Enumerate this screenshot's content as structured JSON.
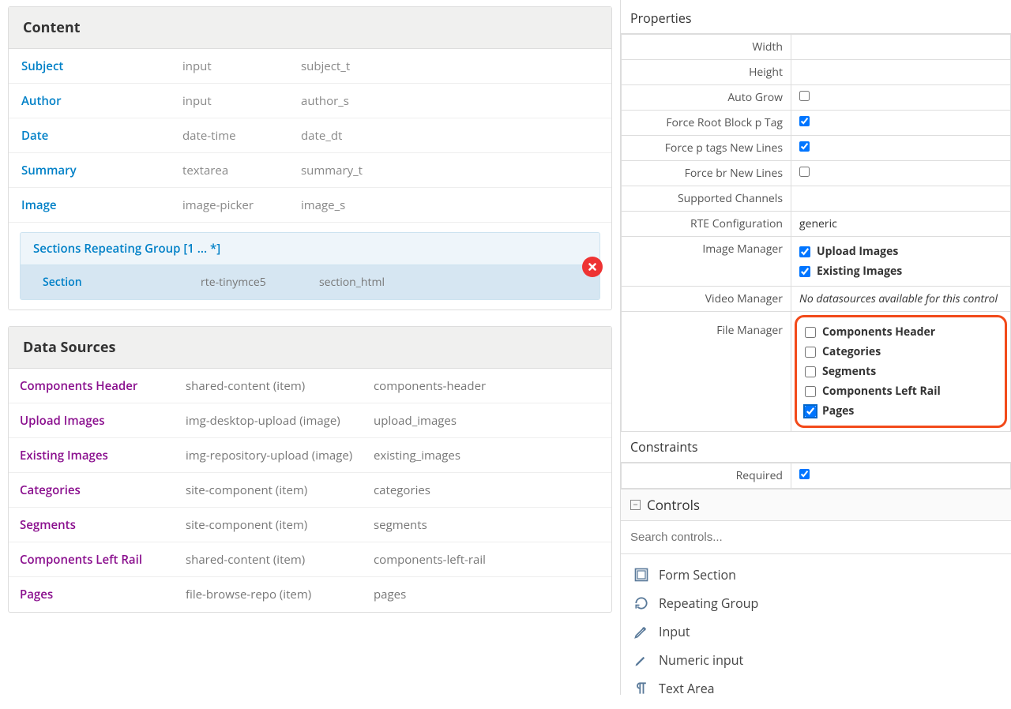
{
  "content": {
    "title": "Content",
    "fields": [
      {
        "label": "Subject",
        "type": "input",
        "var": "subject_t"
      },
      {
        "label": "Author",
        "type": "input",
        "var": "author_s"
      },
      {
        "label": "Date",
        "type": "date-time",
        "var": "date_dt"
      },
      {
        "label": "Summary",
        "type": "textarea",
        "var": "summary_t"
      },
      {
        "label": "Image",
        "type": "image-picker",
        "var": "image_s"
      }
    ],
    "repeat": {
      "title": "Sections Repeating Group [1 ... *]",
      "row": {
        "label": "Section",
        "type": "rte-tinymce5",
        "var": "section_html"
      }
    }
  },
  "datasources": {
    "title": "Data Sources",
    "rows": [
      {
        "name": "Components Header",
        "type": "shared-content (item)",
        "id": "components-header"
      },
      {
        "name": "Upload Images",
        "type": "img-desktop-upload (image)",
        "id": "upload_images"
      },
      {
        "name": "Existing Images",
        "type": "img-repository-upload (image)",
        "id": "existing_images"
      },
      {
        "name": "Categories",
        "type": "site-component (item)",
        "id": "categories"
      },
      {
        "name": "Segments",
        "type": "site-component (item)",
        "id": "segments"
      },
      {
        "name": "Components Left Rail",
        "type": "shared-content (item)",
        "id": "components-left-rail"
      },
      {
        "name": "Pages",
        "type": "file-browse-repo (item)",
        "id": "pages"
      }
    ]
  },
  "properties": {
    "title": "Properties",
    "width": "",
    "height": "",
    "autoGrow": false,
    "forceRootBlockP": true,
    "forcePNewLines": true,
    "forceBrNewLines": false,
    "supportedChannels": "",
    "rteConfig": "generic",
    "imageMgr": [
      {
        "label": "Upload Images",
        "checked": true
      },
      {
        "label": "Existing Images",
        "checked": true
      }
    ],
    "videoMgr": "No datasources available for this control",
    "fileMgr": [
      {
        "label": "Components Header",
        "checked": false
      },
      {
        "label": "Categories",
        "checked": false
      },
      {
        "label": "Segments",
        "checked": false
      },
      {
        "label": "Components Left Rail",
        "checked": false
      },
      {
        "label": "Pages",
        "checked": true
      }
    ],
    "labels": {
      "width": "Width",
      "height": "Height",
      "autoGrow": "Auto Grow",
      "forceRoot": "Force Root Block p Tag",
      "forceP": "Force p tags New Lines",
      "forceBr": "Force br New Lines",
      "channels": "Supported Channels",
      "rte": "RTE Configuration",
      "imgMgr": "Image Manager",
      "vidMgr": "Video Manager",
      "fileMgr": "File Manager"
    }
  },
  "constraints": {
    "title": "Constraints",
    "requiredLabel": "Required",
    "required": true
  },
  "controls": {
    "title": "Controls",
    "searchPlaceholder": "Search controls...",
    "items": [
      {
        "label": "Form Section",
        "icon": "form-section-icon"
      },
      {
        "label": "Repeating Group",
        "icon": "repeat-icon"
      },
      {
        "label": "Input",
        "icon": "pencil-icon"
      },
      {
        "label": "Numeric input",
        "icon": "numeric-icon"
      },
      {
        "label": "Text Area",
        "icon": "paragraph-icon"
      }
    ]
  }
}
